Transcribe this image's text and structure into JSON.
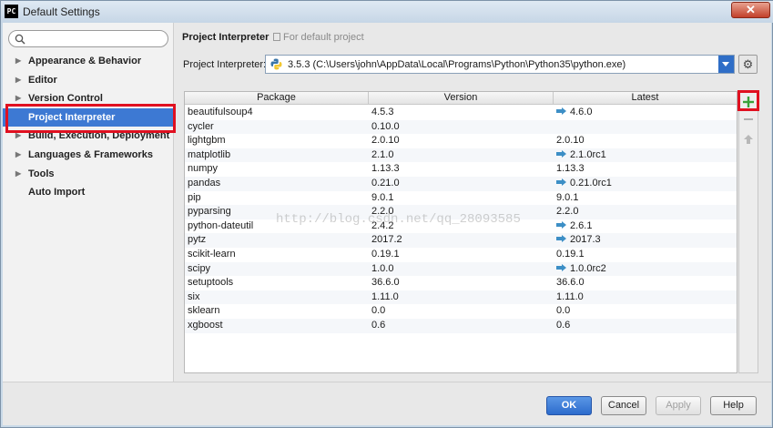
{
  "window": {
    "app_icon": "PC",
    "title": "Default Settings",
    "close_glyph": "✕"
  },
  "search": {
    "value": "",
    "placeholder": ""
  },
  "sidebar": {
    "items": [
      {
        "label": "Appearance & Behavior",
        "expandable": true,
        "selected": false
      },
      {
        "label": "Editor",
        "expandable": true,
        "selected": false
      },
      {
        "label": "Version Control",
        "expandable": true,
        "selected": false
      },
      {
        "label": "Project Interpreter",
        "expandable": false,
        "selected": true
      },
      {
        "label": "Build, Execution, Deployment",
        "expandable": true,
        "selected": false
      },
      {
        "label": "Languages & Frameworks",
        "expandable": true,
        "selected": false
      },
      {
        "label": "Tools",
        "expandable": true,
        "selected": false
      },
      {
        "label": "Auto Import",
        "expandable": false,
        "selected": false
      }
    ],
    "expand_glyph": "▶"
  },
  "main": {
    "title": "Project Interpreter",
    "subtitle": "For default project",
    "interpreter_label": "Project Interpreter:",
    "interpreter_value": "3.5.3 (C:\\Users\\john\\AppData\\Local\\Programs\\Python\\Python35\\python.exe)",
    "gear_glyph": "⚙"
  },
  "table": {
    "columns": [
      "Package",
      "Version",
      "Latest"
    ],
    "rows": [
      {
        "package": "beautifulsoup4",
        "version": "4.5.3",
        "latest": "4.6.0",
        "upgrade": true
      },
      {
        "package": "cycler",
        "version": "0.10.0",
        "latest": "",
        "upgrade": false
      },
      {
        "package": "lightgbm",
        "version": "2.0.10",
        "latest": "2.0.10",
        "upgrade": false
      },
      {
        "package": "matplotlib",
        "version": "2.1.0",
        "latest": "2.1.0rc1",
        "upgrade": true
      },
      {
        "package": "numpy",
        "version": "1.13.3",
        "latest": "1.13.3",
        "upgrade": false
      },
      {
        "package": "pandas",
        "version": "0.21.0",
        "latest": "0.21.0rc1",
        "upgrade": true
      },
      {
        "package": "pip",
        "version": "9.0.1",
        "latest": "9.0.1",
        "upgrade": false
      },
      {
        "package": "pyparsing",
        "version": "2.2.0",
        "latest": "2.2.0",
        "upgrade": false
      },
      {
        "package": "python-dateutil",
        "version": "2.4.2",
        "latest": "2.6.1",
        "upgrade": true
      },
      {
        "package": "pytz",
        "version": "2017.2",
        "latest": "2017.3",
        "upgrade": true
      },
      {
        "package": "scikit-learn",
        "version": "0.19.1",
        "latest": "0.19.1",
        "upgrade": false
      },
      {
        "package": "scipy",
        "version": "1.0.0",
        "latest": "1.0.0rc2",
        "upgrade": true
      },
      {
        "package": "setuptools",
        "version": "36.6.0",
        "latest": "36.6.0",
        "upgrade": false
      },
      {
        "package": "six",
        "version": "1.11.0",
        "latest": "1.11.0",
        "upgrade": false
      },
      {
        "package": "sklearn",
        "version": "0.0",
        "latest": "0.0",
        "upgrade": false
      },
      {
        "package": "xgboost",
        "version": "0.6",
        "latest": "0.6",
        "upgrade": false
      }
    ],
    "watermark": "http://blog.csdn.net/qq_28093585"
  },
  "footer": {
    "ok_label": "OK",
    "cancel_label": "Cancel",
    "apply_label": "Apply",
    "help_label": "Help"
  },
  "colors": {
    "selection": "#3d79d3",
    "highlight_outline": "#e01020",
    "upgrade_arrow": "#3d8fc6",
    "add_icon": "#3aa13a"
  }
}
